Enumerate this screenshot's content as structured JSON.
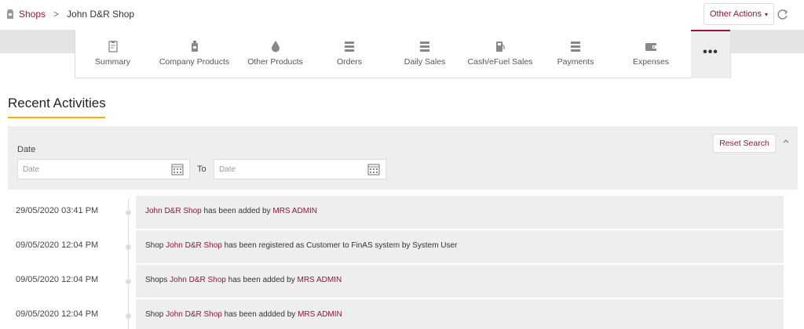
{
  "breadcrumb": {
    "root": "Shops",
    "separator": ">",
    "current": "John D&R Shop"
  },
  "header": {
    "other_actions": "Other Actions",
    "caret": "▾"
  },
  "tabs": [
    {
      "label": "Summary",
      "icon": "clipboard-icon"
    },
    {
      "label": "Company Products",
      "icon": "bottle-icon"
    },
    {
      "label": "Other Products",
      "icon": "drop-icon"
    },
    {
      "label": "Orders",
      "icon": "list-icon"
    },
    {
      "label": "Daily Sales",
      "icon": "list-icon"
    },
    {
      "label": "Cash/eFuel Sales",
      "icon": "fuel-pump-icon"
    },
    {
      "label": "Payments",
      "icon": "list-icon"
    },
    {
      "label": "Expenses",
      "icon": "wallet-icon"
    },
    {
      "label": "•••",
      "icon": "more-icon"
    }
  ],
  "section": {
    "title": "Recent Activities"
  },
  "filter": {
    "date_label": "Date",
    "from_placeholder": "Date",
    "to_label": "To",
    "to_placeholder": "Date",
    "reset_label": "Reset Search"
  },
  "activities": [
    {
      "time": "29/05/2020 03:41 PM",
      "pre": "",
      "link": "John D&R Shop",
      "mid": " has been added by ",
      "link2": "MRS ADMIN",
      "post": ""
    },
    {
      "time": "09/05/2020 12:04 PM",
      "pre": "Shop ",
      "link": "John D&R Shop",
      "mid": " has been registered as Customer to FinAS system by System User",
      "link2": "",
      "post": ""
    },
    {
      "time": "09/05/2020 12:04 PM",
      "pre": "Shops ",
      "link": "John D&R Shop",
      "mid": " has been added by ",
      "link2": "MRS ADMIN",
      "post": ""
    },
    {
      "time": "09/05/2020 12:04 PM",
      "pre": "Shop ",
      "link": "John D&R Shop",
      "mid": " has been addded by ",
      "link2": "MRS ADMIN",
      "post": ""
    }
  ],
  "colors": {
    "accent": "#8b1a3a",
    "underline": "#f0b400",
    "panel": "#eeeeee"
  }
}
